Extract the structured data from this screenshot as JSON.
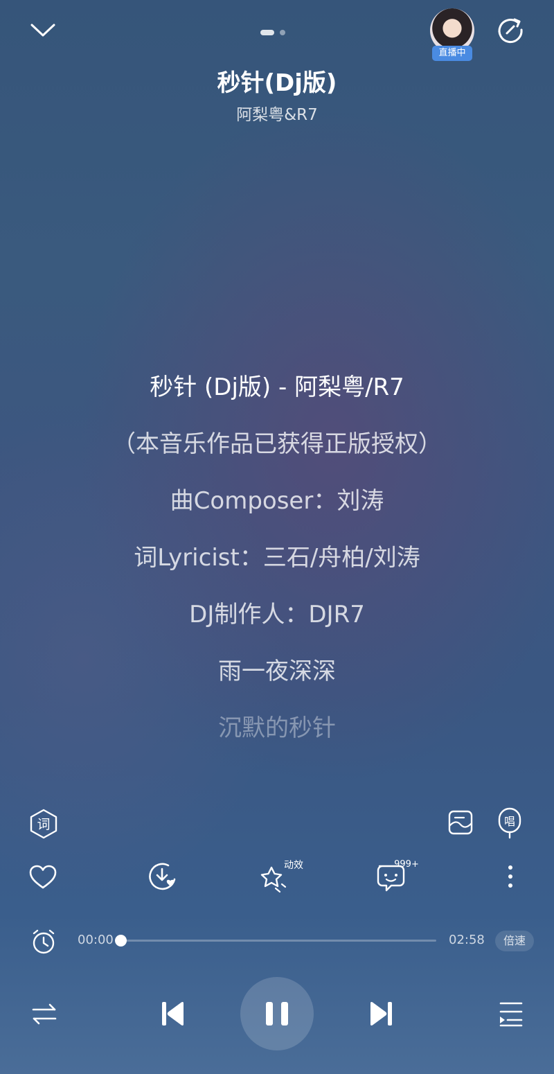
{
  "header": {
    "live_label": "直播中",
    "pager": {
      "total": 2,
      "current": 1
    }
  },
  "song": {
    "title": "秒针(Dj版)",
    "artist": "阿梨粤&R7"
  },
  "lyrics": [
    {
      "text": "秒针 (Dj版) - 阿梨粤/R7",
      "state": "current"
    },
    {
      "text": "（本音乐作品已获得正版授权）",
      "state": "normal"
    },
    {
      "text": "曲Composer：刘涛",
      "state": "normal"
    },
    {
      "text": "词Lyricist：三石/舟柏/刘涛",
      "state": "normal"
    },
    {
      "text": "DJ制作人：DJR7",
      "state": "normal"
    },
    {
      "text": "雨一夜深深",
      "state": "normal"
    },
    {
      "text": "沉默的秒针",
      "state": "faded"
    }
  ],
  "toolbar": {
    "lyrics_icon_char": "词",
    "sing_icon_char": "唱",
    "effects_label": "动效",
    "comment_count": "999+"
  },
  "progress": {
    "elapsed": "00:00",
    "total": "02:58",
    "fraction": 0.0,
    "speed_label": "倍速"
  },
  "icons": {
    "collapse": "chevron-down-icon",
    "share": "share-icon",
    "lyrics": "lyrics-icon",
    "poster": "poster-icon",
    "sing": "sing-icon",
    "like": "heart-icon",
    "download": "download-icon",
    "effects": "effects-icon",
    "comments": "comment-icon",
    "more": "more-icon",
    "timer": "alarm-icon",
    "mode": "repeat-icon",
    "previous": "previous-icon",
    "pause": "pause-icon",
    "next": "next-icon",
    "playlist": "playlist-icon"
  },
  "colors": {
    "background_top": "#36557a",
    "background_bottom": "#4a6d98",
    "live_badge": "#4a8be2"
  }
}
